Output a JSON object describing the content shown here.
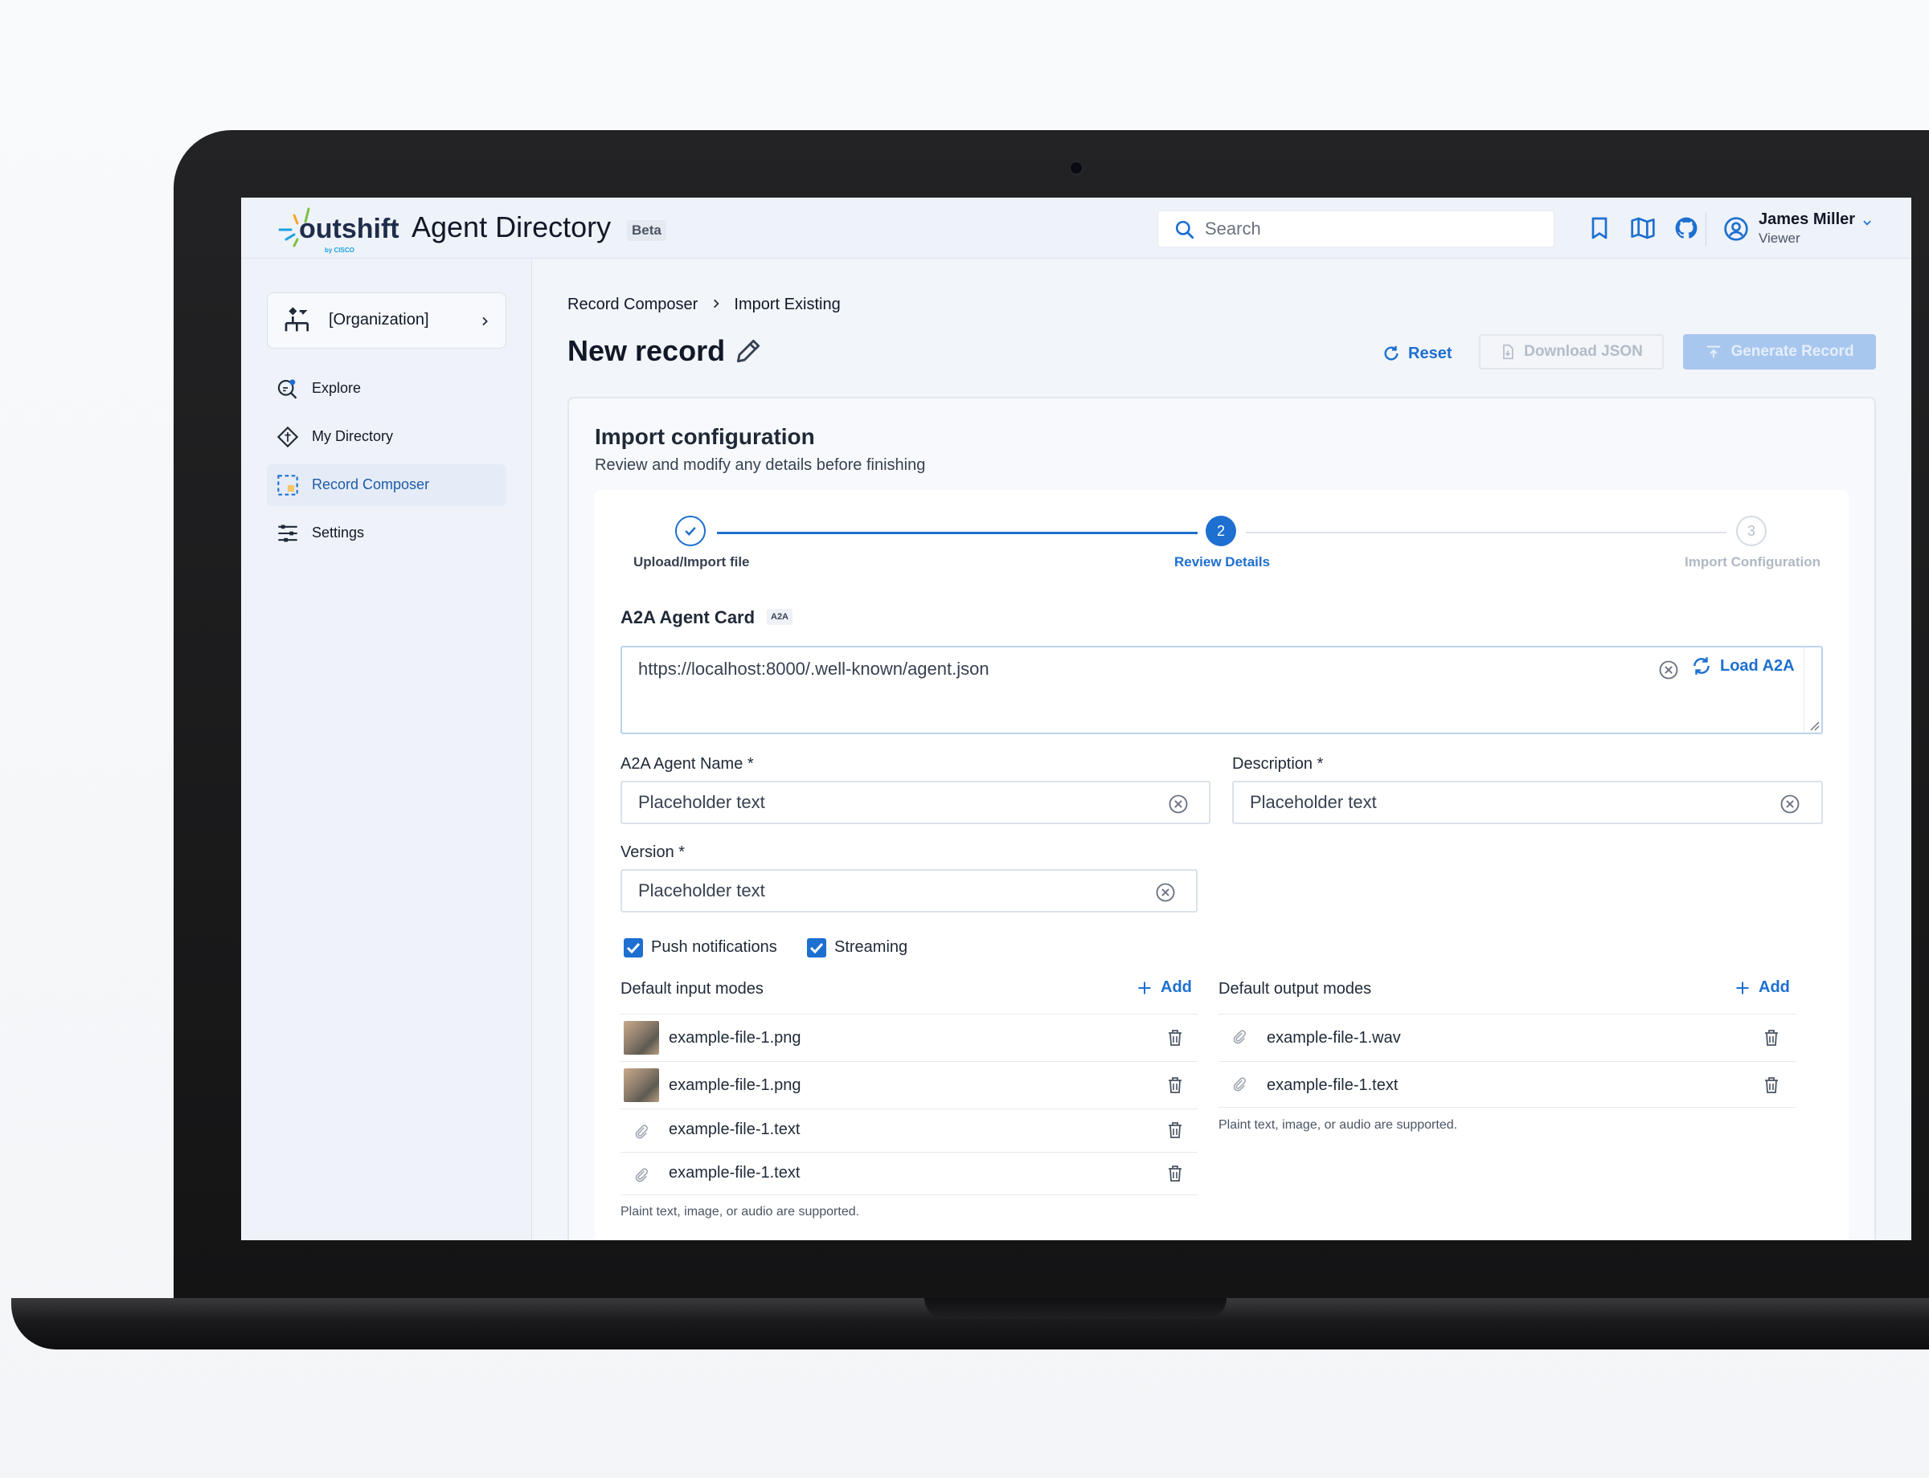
{
  "app": {
    "brand": "outshift",
    "brand_byline": "by CISCO",
    "title": "Agent Directory",
    "badge": "Beta"
  },
  "topbar": {
    "search_placeholder": "Search",
    "icons": [
      "bookmark-icon",
      "book-open-icon",
      "github-icon"
    ],
    "user": {
      "name": "James Miller",
      "role": "Viewer"
    }
  },
  "sidebar": {
    "org_label": "[Organization]",
    "items": [
      {
        "label": "Explore",
        "icon": "explore-icon",
        "active": false
      },
      {
        "label": "My Directory",
        "icon": "directory-icon",
        "active": false
      },
      {
        "label": "Record Composer",
        "icon": "composer-icon",
        "active": true
      },
      {
        "label": "Settings",
        "icon": "settings-icon",
        "active": false
      }
    ]
  },
  "breadcrumb": {
    "parent": "Record Composer",
    "current": "Import Existing"
  },
  "page": {
    "title": "New record",
    "actions": {
      "reset": "Reset",
      "download": "Download JSON",
      "generate": "Generate Record"
    }
  },
  "card": {
    "title": "Import configuration",
    "subtitle": "Review and modify any details before finishing",
    "steps": [
      {
        "label": "Upload/Import file",
        "number": "",
        "status": "done"
      },
      {
        "label": "Review Details",
        "number": "2",
        "status": "current"
      },
      {
        "label": "Import Configuration",
        "number": "3",
        "status": "pending"
      }
    ],
    "agent_card": {
      "label": "A2A Agent Card",
      "badge": "A2A",
      "url": "https://localhost:8000/.well-known/agent.json",
      "load_label": "Load A2A"
    },
    "fields": {
      "name_label": "A2A Agent Name *",
      "name_placeholder": "Placeholder text",
      "description_label": "Description *",
      "description_placeholder": "Placeholder text",
      "version_label": "Version *",
      "version_placeholder": "Placeholder text"
    },
    "checkboxes": [
      {
        "label": "Push notifications",
        "checked": true
      },
      {
        "label": "Streaming",
        "checked": true
      }
    ],
    "input_modes": {
      "label": "Default input modes",
      "add": "Add",
      "files": [
        {
          "name": "example-file-1.png",
          "kind": "image"
        },
        {
          "name": "example-file-1.png",
          "kind": "image"
        },
        {
          "name": "example-file-1.text",
          "kind": "attachment"
        },
        {
          "name": "example-file-1.text",
          "kind": "attachment"
        }
      ],
      "hint": "Plaint text, image, or audio are supported."
    },
    "output_modes": {
      "label": "Default output modes",
      "add": "Add",
      "files": [
        {
          "name": "example-file-1.wav",
          "kind": "attachment"
        },
        {
          "name": "example-file-1.text",
          "kind": "attachment"
        }
      ],
      "hint": "Plaint text, image, or audio are supported."
    }
  },
  "colors": {
    "accent": "#1d6fd0",
    "active_nav_bg": "#e5ecf7",
    "disabled_primary": "#a8c7ee"
  }
}
